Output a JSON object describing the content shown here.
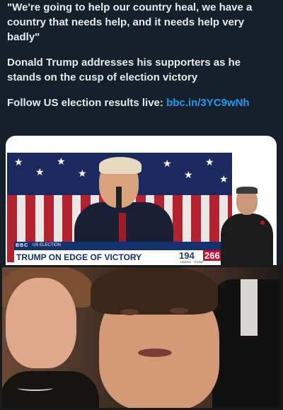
{
  "tweet": {
    "quote": "\"We're going to help our country heal, we have a country that needs help, and it needs help very badly\"",
    "body": "Donald Trump addresses his supporters as he stands on the cusp of election victory",
    "follow_prefix": "Follow US election results live: ",
    "link": "bbc.in/3YC9wNh"
  },
  "broadcast": {
    "logo": "BBC",
    "tag": "US ELECTION",
    "headline": "TRUMP ON EDGE OF VICTORY",
    "harris_votes": "194",
    "trump_votes": "266",
    "harris_label": "HARRIS",
    "trump_label": "TRUMP"
  },
  "colors": {
    "background": "#15202b",
    "link": "#1d9bf0",
    "bbc_blue": "#14316e",
    "trump_red": "#c8102e"
  }
}
